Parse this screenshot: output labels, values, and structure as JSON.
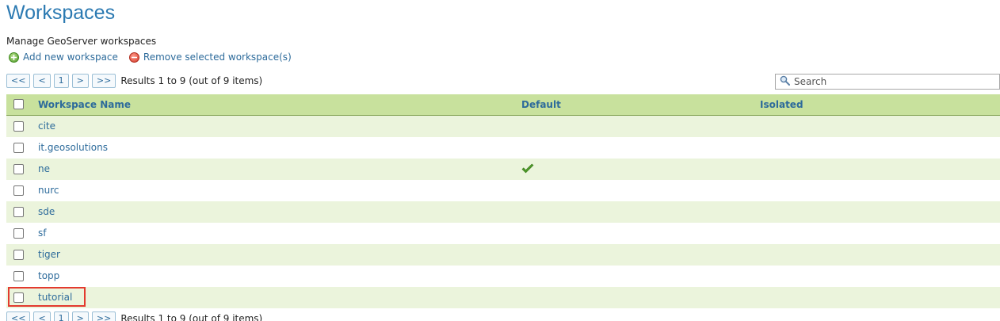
{
  "page": {
    "title": "Workspaces",
    "subtitle": "Manage GeoServer workspaces"
  },
  "actions": {
    "add_label": "Add new workspace",
    "remove_label": "Remove selected workspace(s)"
  },
  "pager": {
    "first": "<<",
    "prev": "<",
    "current": "1",
    "next": ">",
    "last": ">>",
    "status": "Results 1 to 9 (out of 9 items)"
  },
  "search": {
    "placeholder": "Search"
  },
  "table": {
    "headers": {
      "name": "Workspace Name",
      "default": "Default",
      "isolated": "Isolated"
    },
    "rows": [
      {
        "name": "cite",
        "default": false,
        "isolated": false
      },
      {
        "name": "it.geosolutions",
        "default": false,
        "isolated": false
      },
      {
        "name": "ne",
        "default": true,
        "isolated": false
      },
      {
        "name": "nurc",
        "default": false,
        "isolated": false
      },
      {
        "name": "sde",
        "default": false,
        "isolated": false
      },
      {
        "name": "sf",
        "default": false,
        "isolated": false
      },
      {
        "name": "tiger",
        "default": false,
        "isolated": false
      },
      {
        "name": "topp",
        "default": false,
        "isolated": false
      },
      {
        "name": "tutorial",
        "default": false,
        "isolated": false
      }
    ]
  },
  "colors": {
    "title": "#2c7ab2",
    "link": "#2d6b9b",
    "header_bg": "#c8e19d",
    "alt_row_bg": "#ebf4dc",
    "highlight_border": "#e33a2e"
  }
}
